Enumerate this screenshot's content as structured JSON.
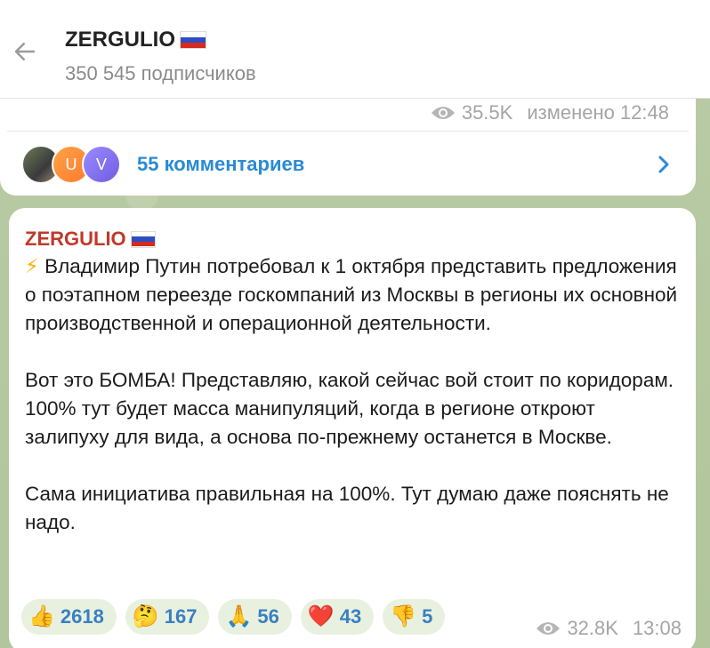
{
  "header": {
    "title": "ZERGULIO",
    "subscribers": "350 545 подписчиков"
  },
  "prev_message": {
    "views": "35.5K",
    "time": "изменено 12:48",
    "comments_label": "55 комментариев",
    "avatars": [
      "",
      "U",
      "V"
    ]
  },
  "message": {
    "author": "ZERGULIO",
    "bolt": "⚡",
    "paragraph1": "Владимир Путин потребовал к 1 октября представить предложения о поэтапном переезде госкомпаний из Москвы в регионы их основной производственной и операционной деятельности.",
    "paragraph2": "Вот это БОМБА! Представляю, какой сейчас вой стоит по коридорам. 100% тут будет масса манипуляций, когда в регионе откроют залипуху для вида, а основа по-прежнему останется в Москве.",
    "paragraph3": "Сама инициатива правильная на 100%. Тут думаю даже пояснять не надо.",
    "reactions": [
      {
        "emoji": "👍",
        "count": "2618"
      },
      {
        "emoji": "🤔",
        "count": "167"
      },
      {
        "emoji": "🙏",
        "count": "56"
      },
      {
        "emoji": "❤️",
        "count": "43"
      },
      {
        "emoji": "👎",
        "count": "5"
      }
    ],
    "views": "32.8K",
    "time": "13:08"
  },
  "colors": {
    "accent": "#2a8ad4",
    "author": "#c0392b",
    "meta": "#a5a5a5"
  }
}
